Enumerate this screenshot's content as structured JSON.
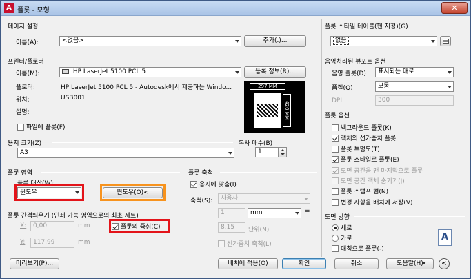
{
  "window": {
    "title": "플롯 - 모형",
    "close_label": "✕",
    "app_icon_label": "A"
  },
  "page_setup": {
    "title": "페이지 설정",
    "name_label": "이름(A):",
    "name_value": "<없음>",
    "add_button": "추가(.)..."
  },
  "printer": {
    "title": "프린터/플로터",
    "name_label": "이름(M):",
    "name_value": "HP LaserJet 5100 PCL 5",
    "properties_button": "등록 정보(R)...",
    "plotter_label": "플로터:",
    "plotter_value": "HP LaserJet 5100 PCL 5 - Autodesk에서 제공하는 Windo...",
    "where_label": "위치:",
    "where_value": "USB001",
    "desc_label": "설명:",
    "plot_to_file_label": "파일에 플롯(F)",
    "preview_width_label": "297 MM",
    "preview_height_label": "420 MM"
  },
  "paper_size": {
    "title": "용지 크기(Z)",
    "value": "A3"
  },
  "copies": {
    "title": "복사 매수(B)",
    "value": "1"
  },
  "plot_area": {
    "title": "플롯 영역",
    "what_label": "플롯 대상(W):",
    "what_value": "윈도우",
    "window_button": "윈도우(O)<"
  },
  "plot_offset": {
    "title": "플롯 간격띄우기 (인쇄 가능 영역으로의 최초 세트)",
    "x_label": "X:",
    "x_value": "0,00",
    "y_label": "Y:",
    "y_value": "117,99",
    "unit": "mm",
    "center_label": "플롯의 중심(C)"
  },
  "plot_scale": {
    "title": "플롯 축척",
    "fit_label": "용지에 맞춤(I)",
    "scale_label": "축척(S):",
    "scale_value": "사용자",
    "value1": "1",
    "unit_value": "mm",
    "value2": "8,15",
    "unit2_label": "단위(N)",
    "lineweights_label": "선가중치 축척(L)"
  },
  "plot_style_table": {
    "title": "플롯 스타일 테이블(펜 지정)(G)",
    "value": "없음"
  },
  "shaded_viewport": {
    "title": "음영처리된 뷰포트 옵션",
    "shade_label": "음영 플롯(D)",
    "shade_value": "표시되는 대로",
    "quality_label": "품질(Q)",
    "quality_value": "보통",
    "dpi_label": "DPI",
    "dpi_value": "300"
  },
  "plot_options": {
    "title": "플롯 옵션",
    "items": [
      {
        "label": "백그라운드 플롯(K)",
        "checked": false,
        "disabled": false
      },
      {
        "label": "객체의 선가중치 플롯",
        "checked": true,
        "disabled": false
      },
      {
        "label": "플롯 투명도(T)",
        "checked": false,
        "disabled": false
      },
      {
        "label": "플롯 스타일로 플롯(E)",
        "checked": true,
        "disabled": false
      },
      {
        "label": "도면 공간을 맨 마지막으로 플롯",
        "checked": true,
        "disabled": true
      },
      {
        "label": "도면 공간 객체 숨기기(J)",
        "checked": false,
        "disabled": true
      },
      {
        "label": "플롯 스탬프 켬(N)",
        "checked": false,
        "disabled": false
      },
      {
        "label": "변경 사항을 배치에 저장(V)",
        "checked": false,
        "disabled": false
      }
    ]
  },
  "orientation": {
    "title": "도면 방향",
    "portrait_label": "세로",
    "landscape_label": "가로",
    "upside_down_label": "대칭으로 플롯(-)",
    "glyph": "A"
  },
  "footer": {
    "preview_button": "미리보기(P)...",
    "apply_button": "배치에 적용(O)",
    "ok_button": "확인",
    "cancel_button": "취소",
    "help_button": "도움말(H)",
    "more_icon": "<"
  }
}
